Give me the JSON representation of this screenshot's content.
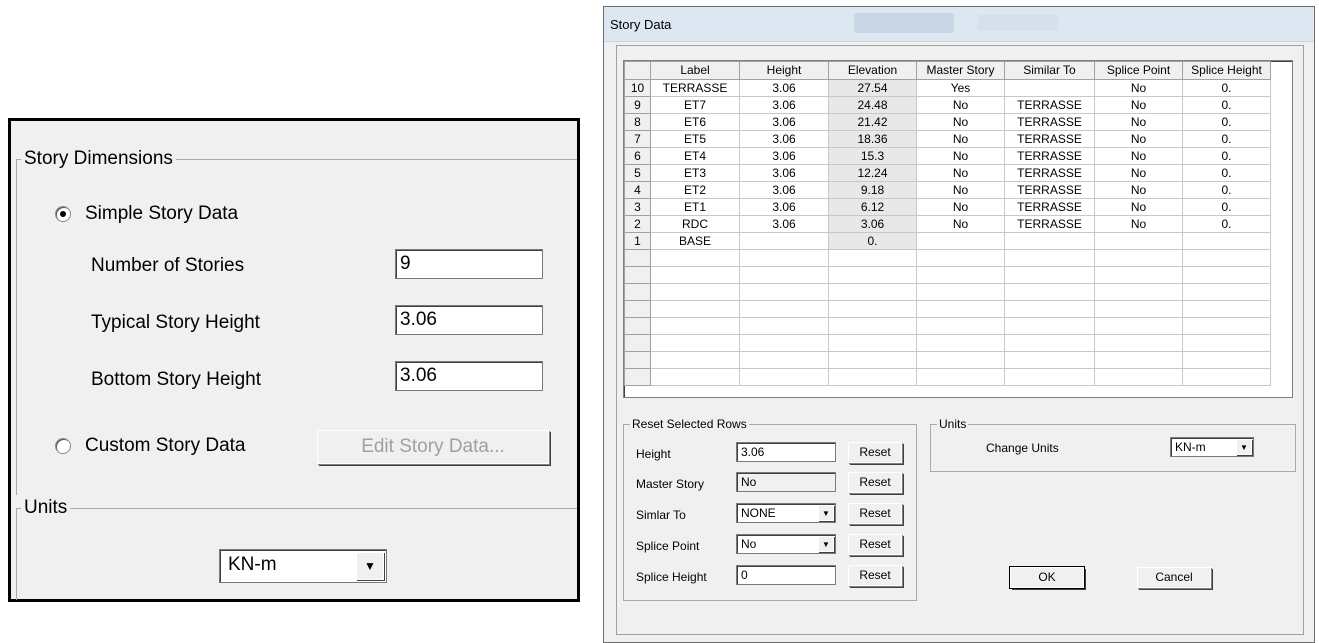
{
  "left_panel": {
    "story_dimensions_title": "Story Dimensions",
    "simple_story_label": "Simple Story Data",
    "simple_story_checked": true,
    "fields": [
      {
        "label": "Number of Stories",
        "value": "9"
      },
      {
        "label": "Typical Story Height",
        "value": "3.06"
      },
      {
        "label": "Bottom Story Height",
        "value": "3.06"
      }
    ],
    "custom_story_label": "Custom Story Data",
    "custom_story_checked": false,
    "edit_button_label": "Edit Story Data...",
    "units_title": "Units",
    "units_value": "KN-m"
  },
  "dialog": {
    "title": "Story Data",
    "table": {
      "headers": [
        "",
        "Label",
        "Height",
        "Elevation",
        "Master Story",
        "Similar To",
        "Splice Point",
        "Splice Height"
      ],
      "rows": [
        [
          "10",
          "TERRASSE",
          "3.06",
          "27.54",
          "Yes",
          "",
          "No",
          "0."
        ],
        [
          "9",
          "ET7",
          "3.06",
          "24.48",
          "No",
          "TERRASSE",
          "No",
          "0."
        ],
        [
          "8",
          "ET6",
          "3.06",
          "21.42",
          "No",
          "TERRASSE",
          "No",
          "0."
        ],
        [
          "7",
          "ET5",
          "3.06",
          "18.36",
          "No",
          "TERRASSE",
          "No",
          "0."
        ],
        [
          "6",
          "ET4",
          "3.06",
          "15.3",
          "No",
          "TERRASSE",
          "No",
          "0."
        ],
        [
          "5",
          "ET3",
          "3.06",
          "12.24",
          "No",
          "TERRASSE",
          "No",
          "0."
        ],
        [
          "4",
          "ET2",
          "3.06",
          "9.18",
          "No",
          "TERRASSE",
          "No",
          "0."
        ],
        [
          "3",
          "ET1",
          "3.06",
          "6.12",
          "No",
          "TERRASSE",
          "No",
          "0."
        ],
        [
          "2",
          "RDC",
          "3.06",
          "3.06",
          "No",
          "TERRASSE",
          "No",
          "0."
        ],
        [
          "1",
          "BASE",
          "",
          "0.",
          "",
          "",
          "",
          ""
        ]
      ],
      "empty_rows": 8
    },
    "reset_group": {
      "title": "Reset Selected Rows",
      "height_label": "Height",
      "height_value": "3.06",
      "master_label": "Master Story",
      "master_value": "No",
      "similar_label": "Simlar To",
      "similar_value": "NONE",
      "splice_point_label": "Splice Point",
      "splice_point_value": "No",
      "splice_height_label": "Splice Height",
      "splice_height_value": "0",
      "reset_label": "Reset"
    },
    "units_group": {
      "title": "Units",
      "change_label": "Change Units",
      "value": "KN-m"
    },
    "ok_label": "OK",
    "cancel_label": "Cancel"
  }
}
